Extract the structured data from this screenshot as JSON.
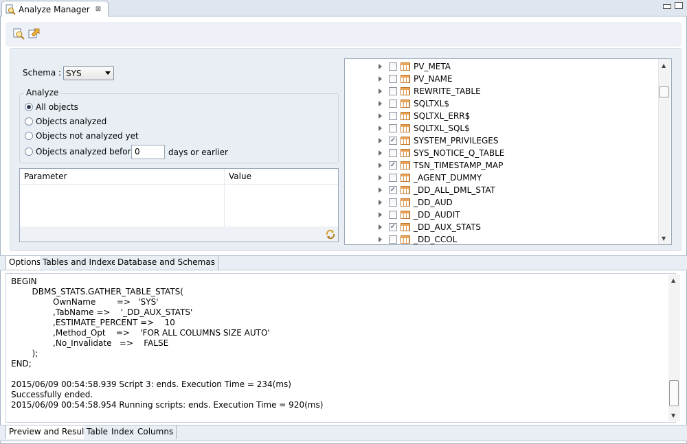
{
  "window": {
    "title": "Analyze Manager"
  },
  "schema": {
    "label": "Schema :",
    "selected": "SYS"
  },
  "analyze": {
    "legend": "Analyze",
    "options": [
      {
        "label": "All objects",
        "selected": true
      },
      {
        "label": "Objects analyzed",
        "selected": false
      },
      {
        "label": "Objects not analyzed yet",
        "selected": false
      },
      {
        "label": "Objects analyzed before",
        "selected": false
      }
    ],
    "days_value": "0",
    "days_suffix": "days or earlier"
  },
  "param_table": {
    "col_parameter": "Parameter",
    "col_value": "Value"
  },
  "tree": {
    "items": [
      {
        "name": "PV_META",
        "checked": false
      },
      {
        "name": "PV_NAME",
        "checked": false
      },
      {
        "name": "REWRITE_TABLE",
        "checked": false
      },
      {
        "name": "SQLTXL$",
        "checked": false
      },
      {
        "name": "SQLTXL_ERR$",
        "checked": false
      },
      {
        "name": "SQLTXL_SQL$",
        "checked": false
      },
      {
        "name": "SYSTEM_PRIVILEGES",
        "checked": true
      },
      {
        "name": "SYS_NOTICE_Q_TABLE",
        "checked": false
      },
      {
        "name": "TSN_TIMESTAMP_MAP",
        "checked": true
      },
      {
        "name": "_AGENT_DUMMY",
        "checked": false
      },
      {
        "name": "_DD_ALL_DML_STAT",
        "checked": true
      },
      {
        "name": "_DD_AUD",
        "checked": false
      },
      {
        "name": "_DD_AUDIT",
        "checked": false
      },
      {
        "name": "_DD_AUX_STATS",
        "checked": true
      },
      {
        "name": "_DD_CCOL",
        "checked": false
      }
    ]
  },
  "config_tabs": [
    "Options",
    "Tables and Indexes",
    "Database and Schemas"
  ],
  "script_lines": [
    "BEGIN",
    "        DBMS_STATS.GATHER_TABLE_STATS(",
    "                OwnName        =>   'SYS'",
    "                ,TabName =>    '_DD_AUX_STATS'",
    "                ,ESTIMATE_PERCENT =>    10",
    "                ,Method_Opt    =>    'FOR ALL COLUMNS SIZE AUTO'",
    "                ,No_Invalidate   =>    FALSE",
    "        );",
    "END;",
    "",
    "2015/06/09 00:54:58.939 Script 3: ends. Execution Time = 234(ms)",
    "Successfully ended.",
    "2015/06/09 00:54:58.954 Running scripts: ends. Execution Time = 920(ms)"
  ],
  "result_tabs": [
    "Preview and Results",
    "Table",
    "Index",
    "Columns"
  ]
}
